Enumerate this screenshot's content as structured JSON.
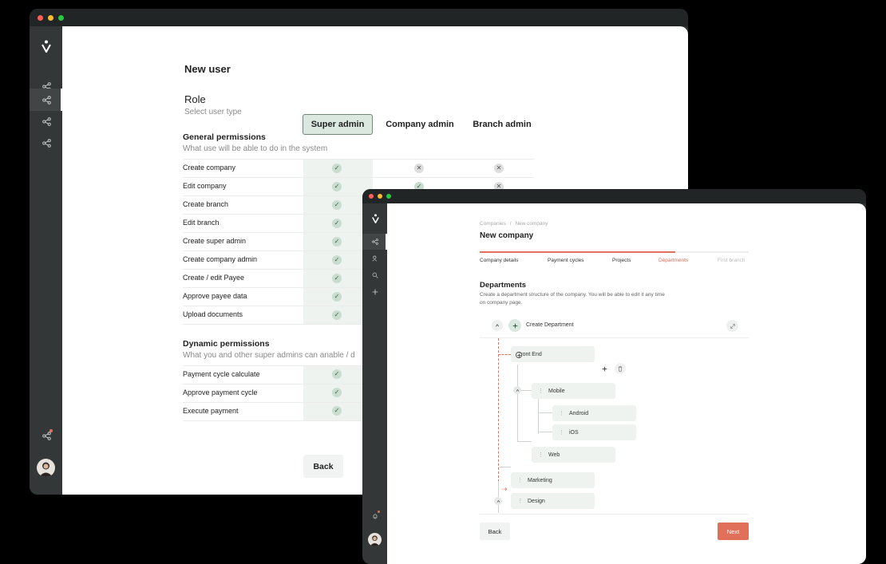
{
  "window_a": {
    "title": "New user",
    "role": {
      "title": "Role",
      "subtitle": "Select user type"
    },
    "role_options": [
      "Super admin",
      "Company admin",
      "Branch admin"
    ],
    "selected_role": "Super admin",
    "general": {
      "title": "General permissions",
      "subtitle": "What use will be able to do in the system",
      "rows": [
        "Create company",
        "Edit company",
        "Create branch",
        "Edit branch",
        "Create super admin",
        "Create company admin",
        "Create / edit Payee",
        "Approve payee data",
        "Upload documents"
      ]
    },
    "dynamic": {
      "title": "Dynamic permissions",
      "subtitle": "What you and other super admins can anable / d",
      "rows": [
        "Payment cycle calculate",
        "Approve payment cycle",
        "Execute payment"
      ]
    },
    "back_label": "Back",
    "check_glyph": "✓",
    "x_glyph": "✕"
  },
  "window_b": {
    "breadcrumb": {
      "parent": "Companies",
      "separator": "/",
      "current": "New company"
    },
    "title": "New company",
    "steps": [
      "Company details",
      "Payment cycles",
      "Projects",
      "Departments",
      "First branch"
    ],
    "active_step": "Departments",
    "section_title": "Departments",
    "section_desc_1": "Create a department structure of the company. You will be able to edit it any time",
    "section_desc_2": "on company page.",
    "create_label": "Create Department",
    "tree": {
      "front_end": "Front End",
      "mobile": "Mobile",
      "android": "Android",
      "ios": "iOS",
      "web": "Web",
      "marketing": "Marketing",
      "design": "Design"
    },
    "back_label": "Back",
    "next_label": "Next"
  },
  "colors": {
    "accent": "#e0705a",
    "selected_bg": "#dbe8df",
    "sidebar": "#343738"
  }
}
